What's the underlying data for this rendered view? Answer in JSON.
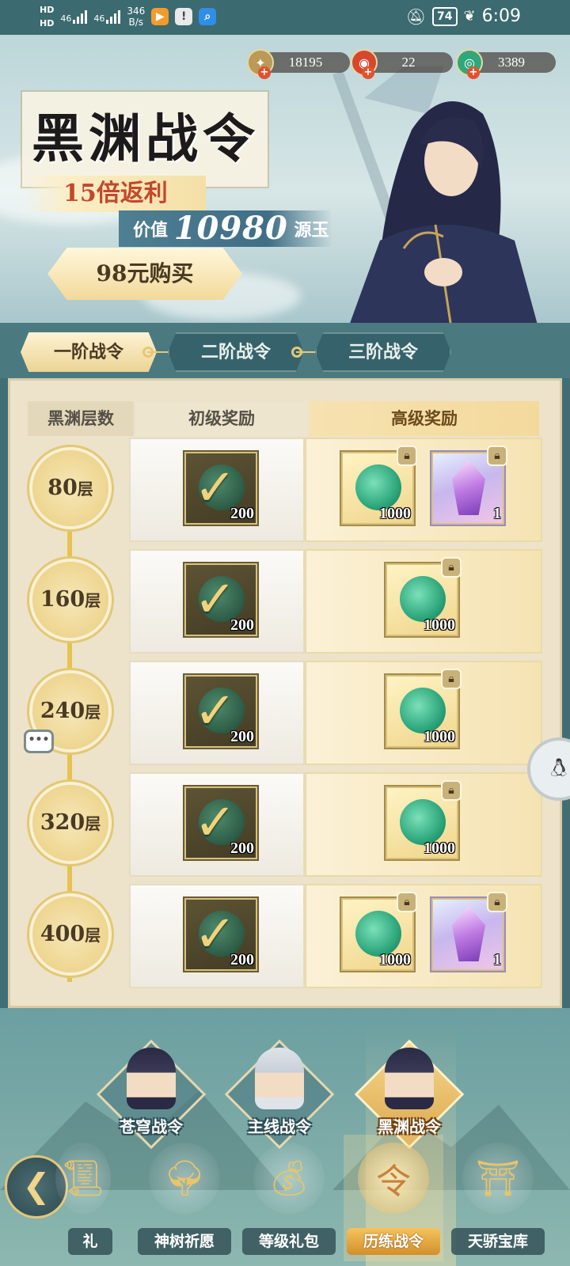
{
  "status_bar": {
    "hd1": "HD",
    "hd2": "HD",
    "sig1": "46",
    "sig2": "46",
    "net_speed_value": "346",
    "net_speed_unit": "B/s",
    "battery": "74",
    "time": "6:09"
  },
  "resources": {
    "coins": "18195",
    "red": "22",
    "jade": "3389"
  },
  "banner": {
    "title": "黑渊战令",
    "rebate": "15倍返利",
    "value_prefix": "价值",
    "value_amount": "10980",
    "value_unit": "源玉",
    "buy_label": "98元购买"
  },
  "tabs": [
    {
      "label": "一阶战令"
    },
    {
      "label": "二阶战令"
    },
    {
      "label": "三阶战令"
    }
  ],
  "reward_table": {
    "headers": {
      "layers": "黑渊层数",
      "basic": "初级奖励",
      "advanced": "高级奖励"
    },
    "tiers": [
      {
        "floor": "80",
        "unit": "层",
        "basic_qty": "200",
        "adv": [
          {
            "type": "jade",
            "qty": "1000"
          },
          {
            "type": "crystal",
            "qty": "1"
          }
        ]
      },
      {
        "floor": "160",
        "unit": "层",
        "basic_qty": "200",
        "adv": [
          {
            "type": "jade",
            "qty": "1000"
          }
        ]
      },
      {
        "floor": "240",
        "unit": "层",
        "basic_qty": "200",
        "adv": [
          {
            "type": "jade",
            "qty": "1000"
          }
        ]
      },
      {
        "floor": "320",
        "unit": "层",
        "basic_qty": "200",
        "adv": [
          {
            "type": "jade",
            "qty": "1000"
          }
        ]
      },
      {
        "floor": "400",
        "unit": "层",
        "basic_qty": "200",
        "adv": [
          {
            "type": "jade",
            "qty": "1000"
          },
          {
            "type": "crystal",
            "qty": "1"
          }
        ]
      }
    ]
  },
  "chat_bubble": "•••",
  "pass_selector": [
    {
      "label": "苍穹战令"
    },
    {
      "label": "主线战令"
    },
    {
      "label": "黑渊战令"
    }
  ],
  "bottom_nav": [
    {
      "label": "礼",
      "icon": "scroll-icon"
    },
    {
      "label": "神树祈愿",
      "icon": "tree-icon"
    },
    {
      "label": "等级礼包",
      "icon": "gift-bag-icon"
    },
    {
      "label": "历练战令",
      "icon": "token-icon"
    },
    {
      "label": "天骄宝库",
      "icon": "gate-icon"
    }
  ],
  "colors": {
    "accent_gold": "#e5c877",
    "teal_bg": "#3f6f74",
    "panel_bg": "#ede3cb"
  }
}
